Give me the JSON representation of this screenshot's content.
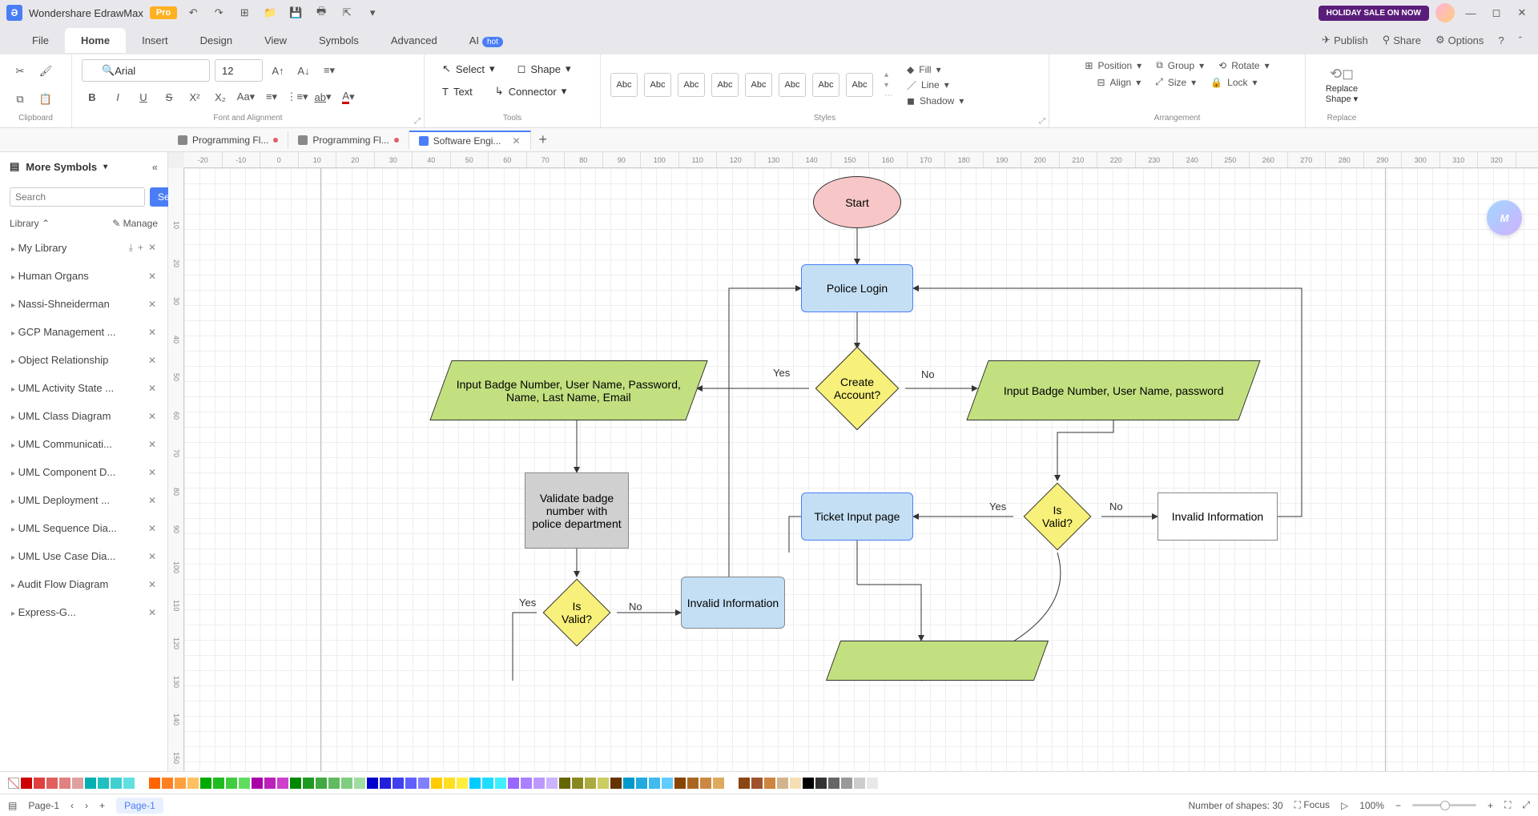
{
  "titlebar": {
    "app_name": "Wondershare EdrawMax",
    "pro": "Pro",
    "holiday": "HOLIDAY SALE ON NOW"
  },
  "menu": {
    "items": [
      "File",
      "Home",
      "Insert",
      "Design",
      "View",
      "Symbols",
      "Advanced",
      "AI"
    ],
    "ai_badge": "hot",
    "right": {
      "publish": "Publish",
      "share": "Share",
      "options": "Options"
    }
  },
  "ribbon": {
    "clipboard_label": "Clipboard",
    "font_label": "Font and Alignment",
    "tools_label": "Tools",
    "styles_label": "Styles",
    "arrangement_label": "Arrangement",
    "replace_label": "Replace",
    "font_name": "Arial",
    "font_size": "12",
    "select": "Select",
    "shape": "Shape",
    "text": "Text",
    "connector": "Connector",
    "style_swatch": "Abc",
    "fill": "Fill",
    "line": "Line",
    "shadow": "Shadow",
    "position": "Position",
    "group": "Group",
    "rotate": "Rotate",
    "align": "Align",
    "size": "Size",
    "lock": "Lock",
    "replace": "Replace",
    "replace_shape": "Shape"
  },
  "tabs": {
    "t1": "Programming Fl...",
    "t2": "Programming Fl...",
    "t3": "Software Engi..."
  },
  "sidebar": {
    "header": "More Symbols",
    "search_placeholder": "Search",
    "search_btn": "Search",
    "library": "Library",
    "manage": "Manage",
    "items": [
      "My Library",
      "Human Organs",
      "Nassi-Shneiderman",
      "GCP Management ...",
      "Object Relationship",
      "UML Activity State ...",
      "UML Class Diagram",
      "UML Communicati...",
      "UML Component D...",
      "UML Deployment ...",
      "UML Sequence Dia...",
      "UML Use Case Dia...",
      "Audit Flow Diagram",
      "Express-G..."
    ]
  },
  "flowchart": {
    "start": "Start",
    "police_login": "Police Login",
    "create_account": "Create Account?",
    "yes": "Yes",
    "no": "No",
    "input_full": "Input Badge Number, User Name, Password, Name, Last Name, Email",
    "input_short": "Input Badge Number, User Name, password",
    "validate": "Validate badge number with police department",
    "is_valid": "Is Valid?",
    "invalid_info": "Invalid Information",
    "ticket_input": "Ticket Input page"
  },
  "ruler_h": [
    "-20",
    "-10",
    "0",
    "10",
    "20",
    "30",
    "40",
    "50",
    "60",
    "70",
    "80",
    "90",
    "100",
    "110",
    "120",
    "130",
    "140",
    "150",
    "160",
    "170",
    "180",
    "190",
    "200",
    "210",
    "220",
    "230",
    "240",
    "250",
    "260",
    "270",
    "280",
    "290",
    "300",
    "310",
    "320"
  ],
  "ruler_v": [
    "",
    "10",
    "20",
    "30",
    "40",
    "50",
    "60",
    "70",
    "80",
    "90",
    "100",
    "110",
    "120",
    "130",
    "140",
    "150"
  ],
  "palette": [
    "#c00",
    "#e04040",
    "#e06060",
    "#e08080",
    "#e0a0a0",
    "#00b0b0",
    "#20c0c0",
    "#40d0d0",
    "#60e0e0",
    "#ffffff",
    "#ff6600",
    "#ff8020",
    "#ffa040",
    "#ffc060",
    "#00aa00",
    "#20bb20",
    "#40cc40",
    "#60dd60",
    "#aa00aa",
    "#bb20bb",
    "#cc40cc",
    "#008800",
    "#209920",
    "#40aa40",
    "#60bb60",
    "#80cc80",
    "#a0dda0",
    "#0000cc",
    "#2020dd",
    "#4040ee",
    "#6060ff",
    "#8080ff",
    "#ffcc00",
    "#ffdd20",
    "#ffee40",
    "#00ccff",
    "#20ddff",
    "#40eeff",
    "#9966ff",
    "#aa80ff",
    "#bb99ff",
    "#ccb3ff",
    "#666600",
    "#888820",
    "#aaaa40",
    "#cccc60",
    "#663300",
    "#0099cc",
    "#20aadd",
    "#40bbee",
    "#60ccff",
    "#884400",
    "#aa6620",
    "#cc8840",
    "#ddaa60",
    "#ffffff",
    "#8b4513",
    "#a0522d",
    "#cd853f",
    "#d2b48c",
    "#f5deb3",
    "#000000",
    "#333333",
    "#666666",
    "#999999",
    "#cccccc",
    "#e8e8e8"
  ],
  "status": {
    "page": "Page-1",
    "active_page": "Page-1",
    "shapes": "Number of shapes: 30",
    "focus": "Focus",
    "zoom": "100%"
  }
}
